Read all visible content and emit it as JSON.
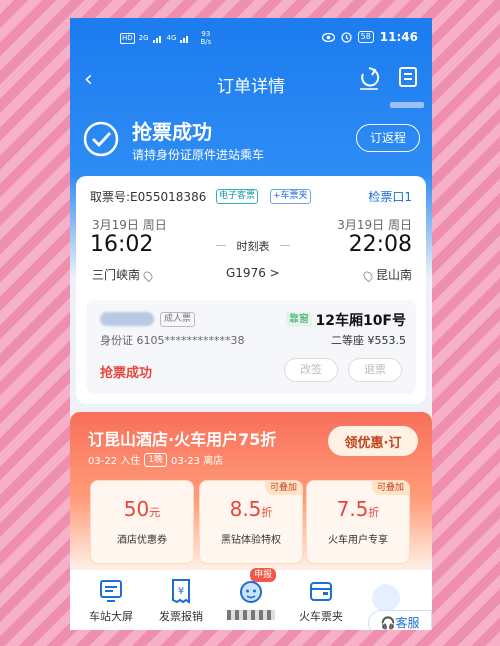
{
  "status_bar": {
    "hd": "HD",
    "net1": "2G",
    "net2": "4G",
    "speed_value": "93",
    "speed_unit": "B/s",
    "battery": "58",
    "time": "11:46"
  },
  "nav": {
    "back_icon": "chevron-left-icon",
    "title": "订单详情",
    "share_icon": "share-icon",
    "menu_icon": "document-icon"
  },
  "success": {
    "title": "抢票成功",
    "subtitle": "请持身份证原件进站乘车",
    "return_button": "订返程"
  },
  "ticket": {
    "ticket_no": "取票号:E055018386",
    "tag_e_ticket": "电子客票",
    "tag_add": "+车票夹",
    "gate": "检票口1",
    "depart_date": "3月19日  周日",
    "arrive_date": "3月19日  周日",
    "depart_time": "16:02",
    "arrive_time": "22:08",
    "schedule_label": "时刻表",
    "depart_station": "三门峡南",
    "train_no": "G1976 >",
    "arrive_station": "昆山南",
    "passenger": {
      "type": "成人票",
      "window": "靠窗",
      "seat": "12车厢10F号",
      "id": "身份证  6105************38",
      "price": "二等座 ¥553.5"
    },
    "status": "抢票成功",
    "change_button": "改签",
    "refund_button": "退票"
  },
  "hotel": {
    "title": "订昆山酒店·火车用户75折",
    "checkin": "03-22 入住",
    "nights": "1晚",
    "checkout": "03-23 离店",
    "coupon_button": "领优惠·订",
    "coupons": [
      {
        "value": "50",
        "unit": "元",
        "label": "酒店优惠券",
        "stack": ""
      },
      {
        "value": "8.5",
        "unit": "折",
        "label": "黑钻体验特权",
        "stack": "可叠加"
      },
      {
        "value": "7.5",
        "unit": "折",
        "label": "火车用户专享",
        "stack": "可叠加"
      }
    ]
  },
  "bottom_tools": [
    {
      "label": "车站大屏",
      "icon": "station-screen-icon"
    },
    {
      "label": "发票报销",
      "icon": "invoice-icon"
    },
    {
      "label": "",
      "icon": "mascot-icon"
    },
    {
      "label": "火车票夹",
      "icon": "ticket-wallet-icon"
    }
  ],
  "report_tag": "申报",
  "service_button": "客服"
}
